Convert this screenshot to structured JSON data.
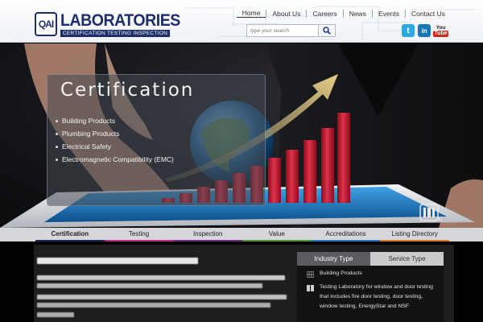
{
  "logo": {
    "badge": "QAI",
    "name": "LABORATORIES",
    "tagline": "CERTIFICATION  TESTING  INSPECTION"
  },
  "topnav": [
    "Home",
    "About Us",
    "Careers",
    "News",
    "Events",
    "Contact Us"
  ],
  "search": {
    "placeholder": "type your search"
  },
  "social": {
    "twitter": "t",
    "linkedin": "in",
    "youtube_top": "You",
    "youtube_bottom": "Tube"
  },
  "hero": {
    "title": "Certification",
    "items": [
      "Building Products",
      "Plumbing Products",
      "Electrical Safety",
      "Electromagnetic Compatibility (EMC)"
    ]
  },
  "tabs": [
    {
      "label": "Certification",
      "color": "#1f2a5c"
    },
    {
      "label": "Testing",
      "color": "#c0308a"
    },
    {
      "label": "Inspection",
      "color": "#7a2c8c"
    },
    {
      "label": "Value",
      "color": "#4f9a3a"
    },
    {
      "label": "Accreditations",
      "color": "#2d7bc4"
    },
    {
      "label": "Listing Directory",
      "color": "#e07a2a"
    }
  ],
  "sidebar": {
    "tabs": [
      "Industry Type",
      "Service Type"
    ],
    "row1": "Building Products",
    "row2_lines": [
      "Testing Laboratory for window and door testing",
      "that includes fire door testing, door testing,",
      "window testing, EnergyStar and NSF"
    ]
  },
  "colors": {
    "brand_navy": "#1f2e6b",
    "bar_red": "#c4162a",
    "arrow_gold": "#d9c27a"
  }
}
